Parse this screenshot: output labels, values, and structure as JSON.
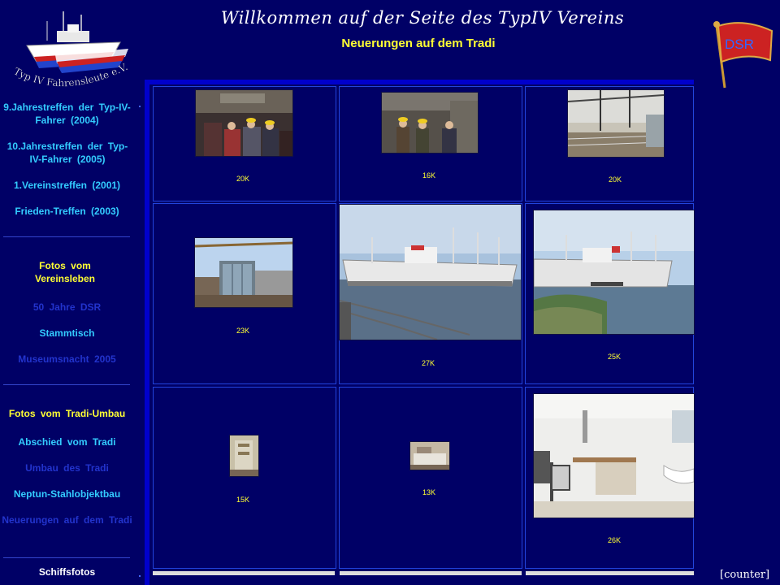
{
  "header": {
    "title": "Willkommen auf der Seite des TypIV Vereins",
    "subtitle": "Neuerungen auf dem Tradi"
  },
  "logo": {
    "text": "Typ IV Fahrensleute e.V."
  },
  "flag": {
    "text": "DSR"
  },
  "sidebar": {
    "items": [
      {
        "label": "9.Jahrestreffen der Typ-IV-Fahrer (2004)",
        "color": "#33ccff"
      },
      {
        "label": "10.Jahrestreffen der Typ-IV-Fahrer (2005)",
        "color": "#33ccff"
      },
      {
        "label": "1.Vereinstreffen (2001)",
        "color": "#33ccff"
      },
      {
        "label": "Frieden-Treffen (2003)",
        "color": "#33ccff"
      },
      {
        "label": "Fotos vom Vereinsleben",
        "color": "#ffff33"
      },
      {
        "label": "50 Jahre DSR",
        "color": "#2233cc"
      },
      {
        "label": "Stammtisch",
        "color": "#33ccff"
      },
      {
        "label": "Museumsnacht 2005",
        "color": "#2233cc"
      },
      {
        "label": "Fotos vom Tradi-Umbau",
        "color": "#ffff33"
      },
      {
        "label": "Abschied vom Tradi",
        "color": "#33ccff"
      },
      {
        "label": "Umbau des Tradi",
        "color": "#2233cc"
      },
      {
        "label": "Neptun-Stahlobjektbau",
        "color": "#33ccff"
      },
      {
        "label": "Neuerungen auf dem Tradi",
        "color": "#2233cc"
      },
      {
        "label": "Schiffsfotos",
        "color": "#ffffff"
      }
    ]
  },
  "gallery": {
    "captions": [
      "20K",
      "16K",
      "20K",
      "23K",
      "27K",
      "25K",
      "15K",
      "13K",
      "26K"
    ]
  },
  "footer": {
    "counter": "[counter]"
  }
}
